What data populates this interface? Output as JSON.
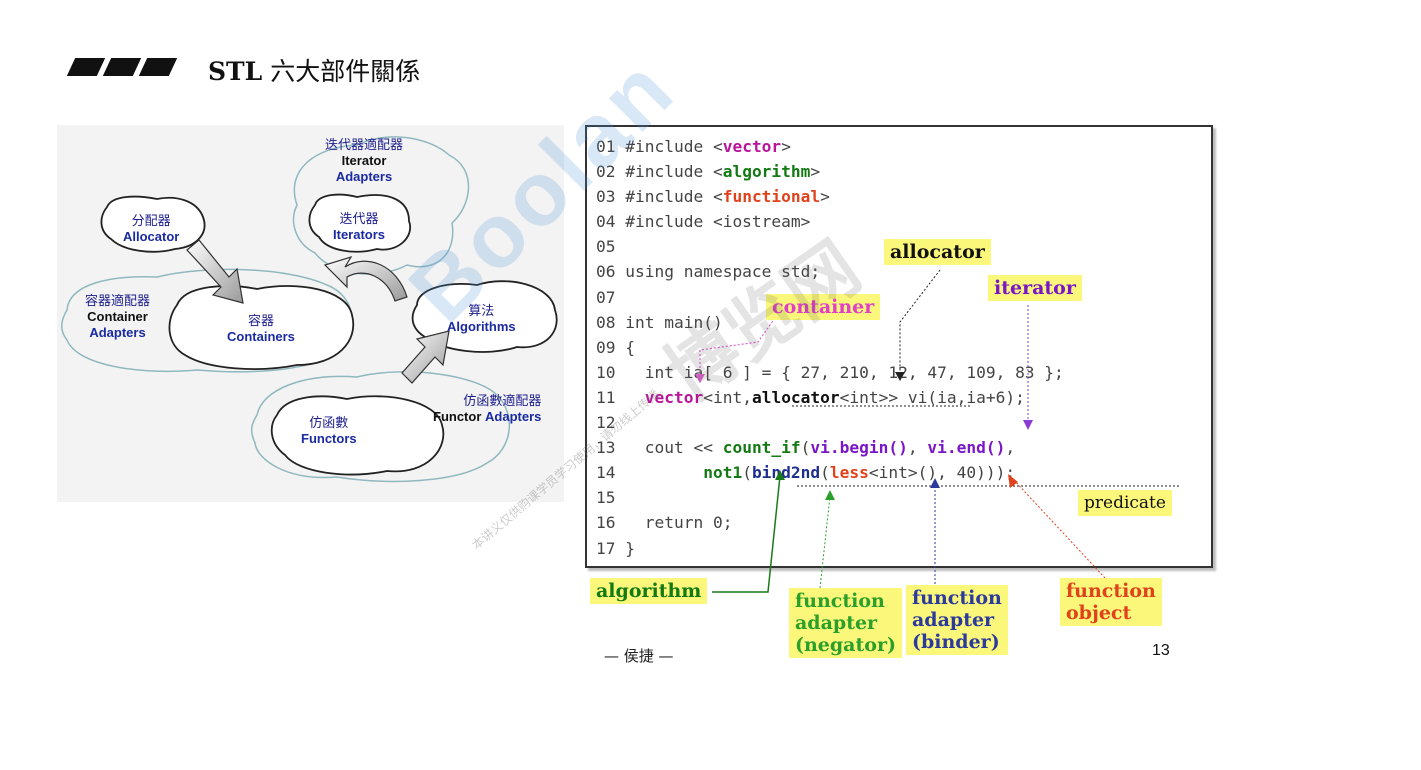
{
  "header": {
    "title_latin": "STL",
    "title_cn": " 六大部件關係"
  },
  "diagram": {
    "iterator_adapters": {
      "cn": "迭代器適配器",
      "en1": "Iterator",
      "en2": "Adapters"
    },
    "iterators": {
      "cn": "迭代器",
      "en": "Iterators"
    },
    "allocator": {
      "cn": "分配器",
      "en": "Allocator"
    },
    "container_adapters": {
      "cn": "容器適配器",
      "en1": "Container",
      "en2": "Adapters"
    },
    "containers": {
      "cn": "容器",
      "en": "Containers"
    },
    "algorithms": {
      "cn": "算法",
      "en": "Algorithms"
    },
    "functor_adapters": {
      "cn": "仿函數適配器",
      "en1": "Functor",
      "en2": "Adapters"
    },
    "functors": {
      "cn": "仿函數",
      "en": "Functors"
    }
  },
  "code": {
    "lines": {
      "l01": [
        "01 #include <",
        "vector",
        ">"
      ],
      "l02": [
        "02 #include <",
        "algorithm",
        ">"
      ],
      "l03": [
        "03 #include <",
        "functional",
        ">"
      ],
      "l04": "04 #include <iostream>",
      "l05": "05",
      "l06": "06 using namespace std;",
      "l07": "07",
      "l08": "08 int main()",
      "l09": "09 {",
      "l10": "10   int ia[ 6 ] = { 27, 210, 12, 47, 109, 83 };",
      "l11": [
        "11   ",
        "vector",
        "<int,",
        "allocator",
        "<int>> vi(ia,ia+6);"
      ],
      "l12": "12",
      "l13": [
        "13   cout << ",
        "count_if",
        "(",
        "vi.begin()",
        ", ",
        "vi.end()",
        ","
      ],
      "l14": [
        "14         ",
        "not1",
        "(",
        "bind2nd",
        "(",
        "less",
        "<int>(), 40)));"
      ],
      "l15": "15",
      "l16": "16   return 0;",
      "l17": "17 }"
    }
  },
  "callouts": {
    "allocator": "allocator",
    "iterator": "iterator",
    "container": "container",
    "predicate": "predicate",
    "algorithm": "algorithm",
    "negator": [
      "function",
      "adapter",
      "(negator)"
    ],
    "binder": [
      "function",
      "adapter",
      "(binder)"
    ],
    "function_object": [
      "function",
      "object"
    ]
  },
  "footer": {
    "author": "— 侯捷 —",
    "page_number": "13"
  },
  "watermark": {
    "text": "Boolan",
    "cn": "博览网",
    "notice": "本讲义仅供购课学员学习使用，请勿线上传播。"
  },
  "colors": {
    "tag_bg": "#fbf77a",
    "vector_magenta": "#b8159a",
    "algorithm_green": "#137a13",
    "functional_red": "#e0421b",
    "iterator_purple": "#7a16c8",
    "binder_blue": "#1f2f8f"
  }
}
